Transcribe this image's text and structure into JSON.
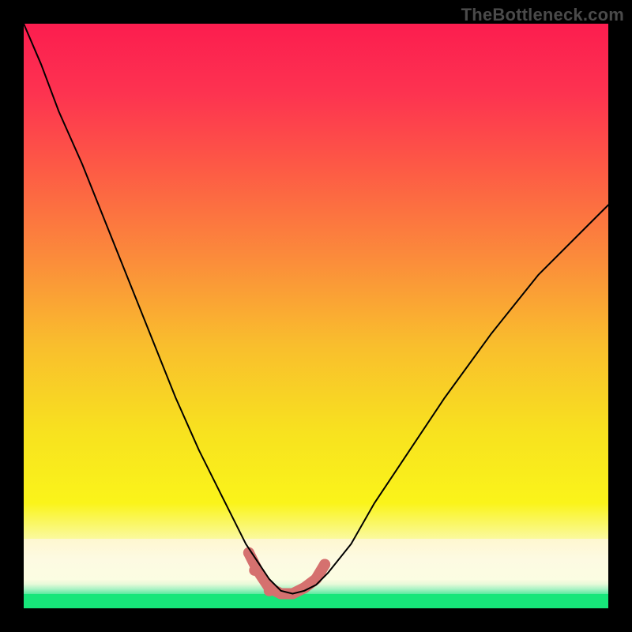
{
  "watermark": "TheBottleneck.com",
  "gradient": {
    "stops": [
      {
        "offset": 0.0,
        "color": "#fc1d4f"
      },
      {
        "offset": 0.12,
        "color": "#fd3350"
      },
      {
        "offset": 0.25,
        "color": "#fd5b45"
      },
      {
        "offset": 0.4,
        "color": "#fb8b3b"
      },
      {
        "offset": 0.55,
        "color": "#f9be2d"
      },
      {
        "offset": 0.7,
        "color": "#f8e21f"
      },
      {
        "offset": 0.82,
        "color": "#faf41a"
      },
      {
        "offset": 0.9,
        "color": "#fbfbc8"
      },
      {
        "offset": 1.0,
        "color": "#fbfde2"
      }
    ]
  },
  "curve": {
    "color": "#000000",
    "width": 2.0,
    "minimum_x_fraction": 0.44,
    "minimum_depth_fraction": 0.975
  },
  "accent": {
    "color": "#d5716f",
    "stroke_width": 14,
    "dot_radius": 7
  },
  "chart_data": {
    "type": "line",
    "title": "",
    "xlabel": "",
    "ylabel": "",
    "xlim": [
      0,
      1
    ],
    "ylim": [
      0,
      1
    ],
    "x": [
      0.0,
      0.03,
      0.06,
      0.1,
      0.14,
      0.18,
      0.22,
      0.26,
      0.3,
      0.34,
      0.38,
      0.4,
      0.42,
      0.44,
      0.46,
      0.48,
      0.5,
      0.52,
      0.56,
      0.6,
      0.66,
      0.72,
      0.8,
      0.88,
      0.96,
      1.0
    ],
    "values": [
      1.0,
      0.93,
      0.85,
      0.76,
      0.66,
      0.56,
      0.46,
      0.36,
      0.27,
      0.19,
      0.11,
      0.08,
      0.05,
      0.03,
      0.025,
      0.03,
      0.04,
      0.06,
      0.11,
      0.18,
      0.27,
      0.36,
      0.47,
      0.57,
      0.65,
      0.69
    ],
    "note": "x and values are normalized fractions of the plot area (0 = left/bottom, 1 = right/top). The y 'values' measure height above the plot bottom; in the rendered image higher y means closer to the top (red) and lower y means near the bottom (green). Minimum of the V-curve is around x≈0.44.",
    "accent_segment": {
      "x": [
        0.385,
        0.4,
        0.42,
        0.44,
        0.46,
        0.48,
        0.5,
        0.515
      ],
      "values": [
        0.095,
        0.065,
        0.035,
        0.025,
        0.025,
        0.035,
        0.05,
        0.075
      ]
    },
    "accent_points": {
      "x": [
        0.385,
        0.395,
        0.42,
        0.44,
        0.46,
        0.48,
        0.5,
        0.515
      ],
      "values": [
        0.095,
        0.065,
        0.03,
        0.025,
        0.025,
        0.035,
        0.05,
        0.075
      ]
    }
  }
}
